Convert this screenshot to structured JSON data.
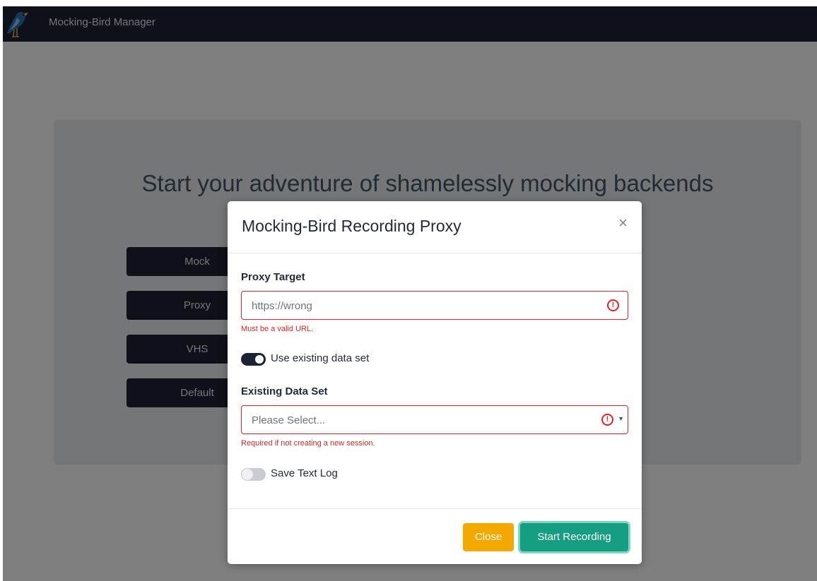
{
  "navbar": {
    "brand": "Mocking-Bird Manager",
    "logo_icon": "bird-logo-icon",
    "background": "#1c2333"
  },
  "hero": {
    "headline": "Start your adventure of shamelessly mocking backends",
    "buttons": [
      {
        "label": "Mock"
      },
      {
        "label": "Proxy"
      },
      {
        "label": "VHS"
      },
      {
        "label": "Default"
      }
    ]
  },
  "modal": {
    "title": "Mocking-Bird Recording Proxy",
    "close_icon": "close-icon",
    "proxy_target": {
      "label": "Proxy Target",
      "value": "https://wrong",
      "error": "Must be a valid URL."
    },
    "use_existing": {
      "label": "Use existing data set",
      "checked": true
    },
    "existing_data_set": {
      "label": "Existing Data Set",
      "placeholder": "Please Select...",
      "error": "Required if not creating a new session."
    },
    "save_text_log": {
      "label": "Save Text Log",
      "checked": false
    },
    "footer": {
      "close_label": "Close",
      "start_label": "Start Recording"
    },
    "colors": {
      "error": "#e02424",
      "close_button": "#f5a800",
      "start_button": "#159e82"
    }
  }
}
